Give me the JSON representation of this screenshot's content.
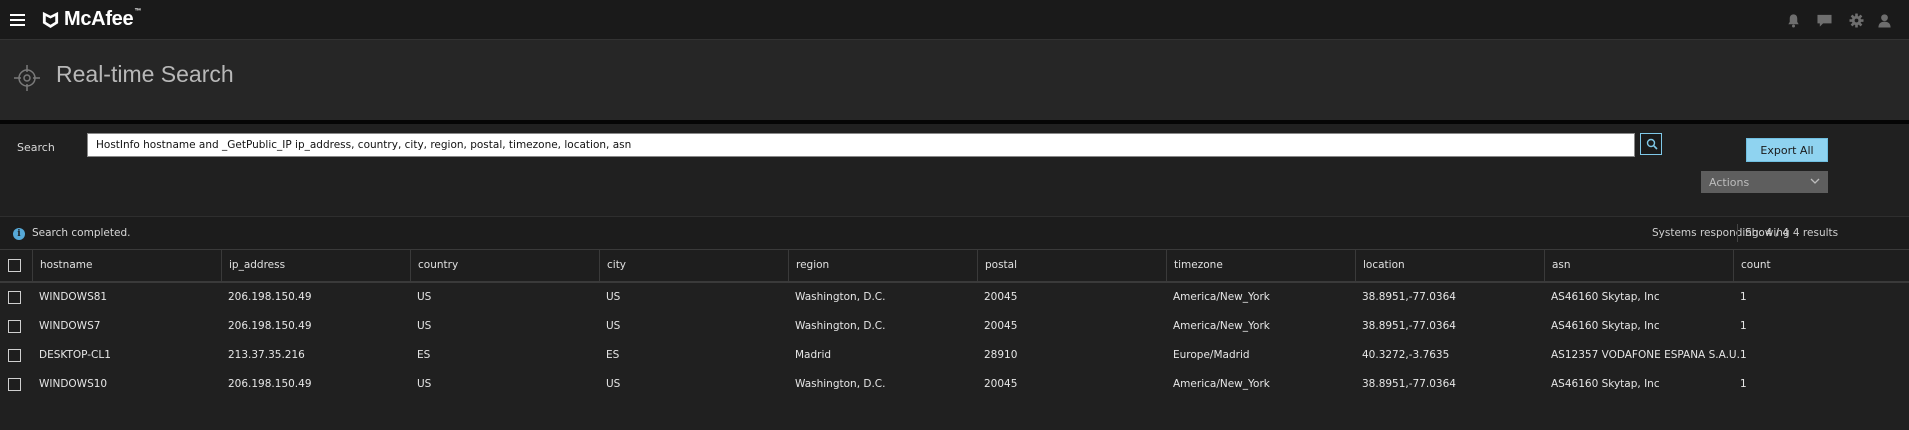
{
  "brand": {
    "name": "McAfee",
    "reg_mark": "™"
  },
  "header_icons": [
    "bell-icon",
    "chat-icon",
    "gear-icon",
    "user-icon"
  ],
  "page": {
    "title": "Real-time Search"
  },
  "search": {
    "label": "Search",
    "query": "HostInfo hostname and _GetPublic_IP ip_address, country, city, region, postal, timezone, location, asn"
  },
  "buttons": {
    "export_all": "Export All",
    "actions": "Actions"
  },
  "status": {
    "message": "Search completed.",
    "responding": "Systems responding: 4 / 4",
    "showing": "Showing 4 results"
  },
  "table": {
    "columns": [
      "hostname",
      "ip_address",
      "country",
      "city",
      "region",
      "postal",
      "timezone",
      "location",
      "asn",
      "count"
    ],
    "rows": [
      [
        "WINDOWS81",
        "206.198.150.49",
        "US",
        "US",
        "Washington, D.C.",
        "20045",
        "America/New_York",
        "38.8951,-77.0364",
        "AS46160 Skytap, Inc",
        "1"
      ],
      [
        "WINDOWS7",
        "206.198.150.49",
        "US",
        "US",
        "Washington, D.C.",
        "20045",
        "America/New_York",
        "38.8951,-77.0364",
        "AS46160 Skytap, Inc",
        "1"
      ],
      [
        "DESKTOP-CL1",
        "213.37.35.216",
        "ES",
        "ES",
        "Madrid",
        "28910",
        "Europe/Madrid",
        "40.3272,-3.7635",
        "AS12357 VODAFONE ESPANA S.A.U.",
        "1"
      ],
      [
        "WINDOWS10",
        "206.198.150.49",
        "US",
        "US",
        "Washington, D.C.",
        "20045",
        "America/New_York",
        "38.8951,-77.0364",
        "AS46160 Skytap, Inc",
        "1"
      ]
    ]
  },
  "colors": {
    "accent": "#8fd3f0",
    "background": "#202020",
    "topbar": "#1a1a1a",
    "info": "#56a9d8"
  }
}
